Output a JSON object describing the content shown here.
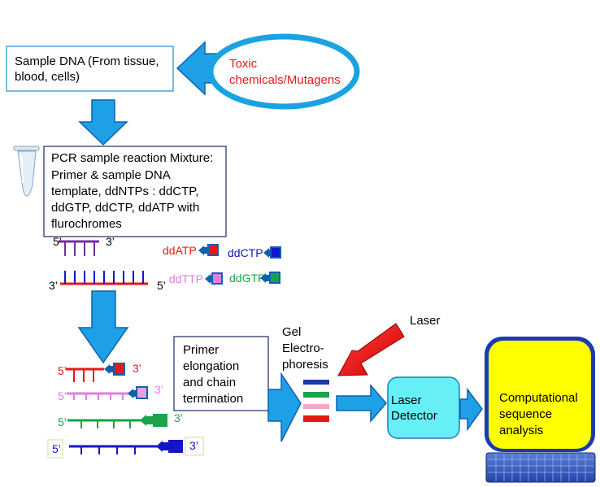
{
  "sample_box": {
    "line1": "Sample DNA (From tissue,",
    "line2": "blood, cells)"
  },
  "toxic": {
    "line1": "Toxic",
    "line2": "chemicals/Mutagens"
  },
  "pcr_box": {
    "line1": "PCR sample reaction Mixture:",
    "line2": "Primer & sample DNA",
    "line3": "template, ddNTPs : ddCTP,",
    "line4": "ddGTP, ddCTP, ddATP with",
    "line5": "flurochromes"
  },
  "strands": {
    "primer_5": "5’",
    "primer_3": "3’",
    "template_3": "3’",
    "template_5": "5’"
  },
  "ddntps": {
    "atp": "ddATP",
    "ctp": "ddCTP",
    "ttp": "ddTTP",
    "gtp": "ddGTP"
  },
  "fragments": [
    {
      "left": "5’",
      "right": "3’"
    },
    {
      "left": "5’",
      "right": "3’"
    },
    {
      "left": "5’",
      "right": "3’"
    },
    {
      "left": "5’",
      "right": "3’"
    }
  ],
  "elongation_box": {
    "line1": "Primer",
    "line2": "elongation",
    "line3": "and chain",
    "line4": "termination"
  },
  "gel": {
    "line1": "Gel",
    "line2": "Electro-",
    "line3": "phoresis"
  },
  "laser_label": "Laser",
  "detector": {
    "line1": "Laser",
    "line2": "Detector"
  },
  "computer": {
    "line1": "Computational",
    "line2": "sequence",
    "line3": "analysis"
  },
  "colors": {
    "arrow_fill": "#1ea0e6",
    "arrow_stroke": "#1060b0",
    "box_border": "#1c8fc8",
    "ellipse": "#1aa3e0",
    "toxic_text": "#e41a1a",
    "red": "#e41a1a",
    "purple": "#7030a0",
    "blue": "#1515c8",
    "pink": "#e07ee0",
    "green": "#1aa34a",
    "detector_fill": "#66f0f5",
    "computer_fill": "#ffff00"
  }
}
